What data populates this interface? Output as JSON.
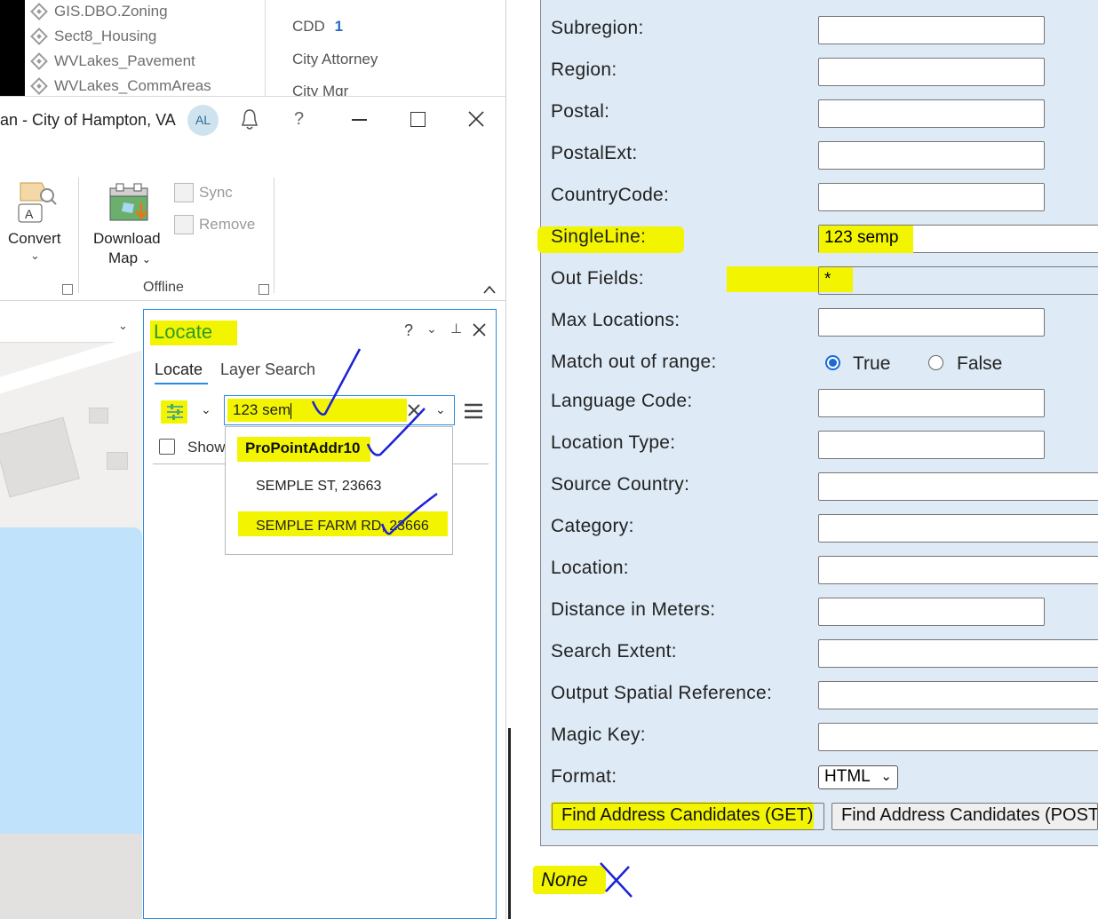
{
  "toc": {
    "layers": [
      "GIS.DBO.Zoning",
      "Sect8_Housing",
      "WVLakes_Pavement",
      "WVLakes_CommAreas"
    ],
    "right_items": [
      {
        "label": "CDD",
        "badge": "1"
      },
      {
        "label": "City Attorney",
        "badge": ""
      },
      {
        "label": "City Mgr",
        "badge": ""
      }
    ]
  },
  "titlebar": {
    "title": "an - City of Hampton, VA",
    "avatar": "AL",
    "help": "?"
  },
  "ribbon": {
    "convert_label": "Convert",
    "download_label_1": "Download",
    "download_label_2": "Map",
    "sync_label": "Sync",
    "remove_label": "Remove",
    "group_label": "Offline"
  },
  "locate": {
    "pane_title": "Locate",
    "help": "?",
    "tabs": [
      "Locate",
      "Layer Search"
    ],
    "search_value": "123 sem",
    "show_label": "Show",
    "dropdown": {
      "header": "ProPointAddr10",
      "items": [
        "SEMPLE ST, 23663",
        "SEMPLE FARM RD, 23666"
      ]
    }
  },
  "form": {
    "fields": [
      {
        "label": "Subregion:",
        "value": "",
        "wide": false
      },
      {
        "label": "Region:",
        "value": "",
        "wide": false
      },
      {
        "label": "Postal:",
        "value": "",
        "wide": false
      },
      {
        "label": "PostalExt:",
        "value": "",
        "wide": false
      },
      {
        "label": "CountryCode:",
        "value": "",
        "wide": false
      },
      {
        "label": "SingleLine:",
        "value": "123 semp",
        "wide": true
      },
      {
        "label": "Out Fields:",
        "value": "*",
        "wide": true
      },
      {
        "label": "Max Locations:",
        "value": "",
        "wide": false
      }
    ],
    "match_label": "Match out of range:",
    "match_true": "True",
    "match_false": "False",
    "match_selected": "True",
    "fields2": [
      {
        "label": "Language Code:",
        "value": "",
        "wide": false
      },
      {
        "label": "Location Type:",
        "value": "",
        "wide": false
      },
      {
        "label": "Source Country:",
        "value": "",
        "wide": true
      },
      {
        "label": "Category:",
        "value": "",
        "wide": true
      },
      {
        "label": "Location:",
        "value": "",
        "wide": true
      },
      {
        "label": "Distance in Meters:",
        "value": "",
        "wide": false
      },
      {
        "label": "Search Extent:",
        "value": "",
        "wide": true
      },
      {
        "label": "Output Spatial Reference:",
        "value": "",
        "wide": true
      },
      {
        "label": "Magic Key:",
        "value": "",
        "wide": true
      }
    ],
    "format_label": "Format:",
    "format_value": "HTML",
    "get_button": "Find Address Candidates (GET)",
    "post_button": "Find Address Candidates (POST)"
  },
  "result": "None",
  "colors": {
    "highlight": "#f3f500",
    "pen": "#1c22d6",
    "form_bg": "#deeaf5",
    "accent": "#2b8be0"
  }
}
